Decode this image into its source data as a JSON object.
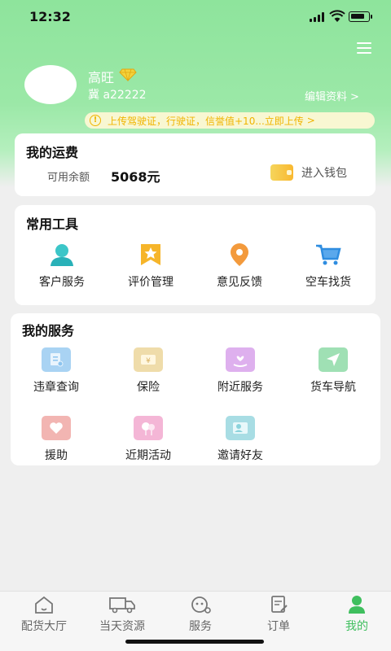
{
  "status_bar": {
    "time": "12:32"
  },
  "profile": {
    "name": "高旺",
    "plate": "冀 a22222",
    "edit_label": "编辑资料",
    "chevron": ">"
  },
  "notice": {
    "warn_glyph": "!",
    "text": "上传驾驶证，行驶证，信誉值+10...立即上传",
    "chevron": ">"
  },
  "freight": {
    "title": "我的运费",
    "balance_label": "可用余额",
    "balance_value": "5068元",
    "wallet_label": "进入钱包"
  },
  "tools": {
    "title": "常用工具",
    "items": [
      {
        "label": "客户服务",
        "icon": "customer-service-icon"
      },
      {
        "label": "评价管理",
        "icon": "review-icon"
      },
      {
        "label": "意见反馈",
        "icon": "feedback-icon"
      },
      {
        "label": "空车找货",
        "icon": "cart-icon"
      }
    ]
  },
  "services": {
    "title": "我的服务",
    "items": [
      {
        "label": "违章查询",
        "icon": "violation-query-icon",
        "color": "#8cc4ef"
      },
      {
        "label": "保险",
        "icon": "insurance-icon",
        "color": "#ead39a"
      },
      {
        "label": "附近服务",
        "icon": "nearby-service-icon",
        "color": "#d9a2ea"
      },
      {
        "label": "货车导航",
        "icon": "navigation-icon",
        "color": "#8ad8a4"
      },
      {
        "label": "援助",
        "icon": "assistance-icon",
        "color": "#eea2a2"
      },
      {
        "label": "近期活动",
        "icon": "activity-icon",
        "color": "#f0a4cc"
      },
      {
        "label": "邀请好友",
        "icon": "invite-friend-icon",
        "color": "#8bd3dc"
      }
    ]
  },
  "tabbar": {
    "tabs": [
      {
        "label": "配货大厅",
        "icon": "home-icon",
        "active": false
      },
      {
        "label": "当天资源",
        "icon": "truck-icon",
        "active": false
      },
      {
        "label": "服务",
        "icon": "service-icon",
        "active": false
      },
      {
        "label": "订单",
        "icon": "order-icon",
        "active": false
      },
      {
        "label": "我的",
        "icon": "profile-icon",
        "active": true
      }
    ],
    "active_color": "#3fbf5e"
  }
}
